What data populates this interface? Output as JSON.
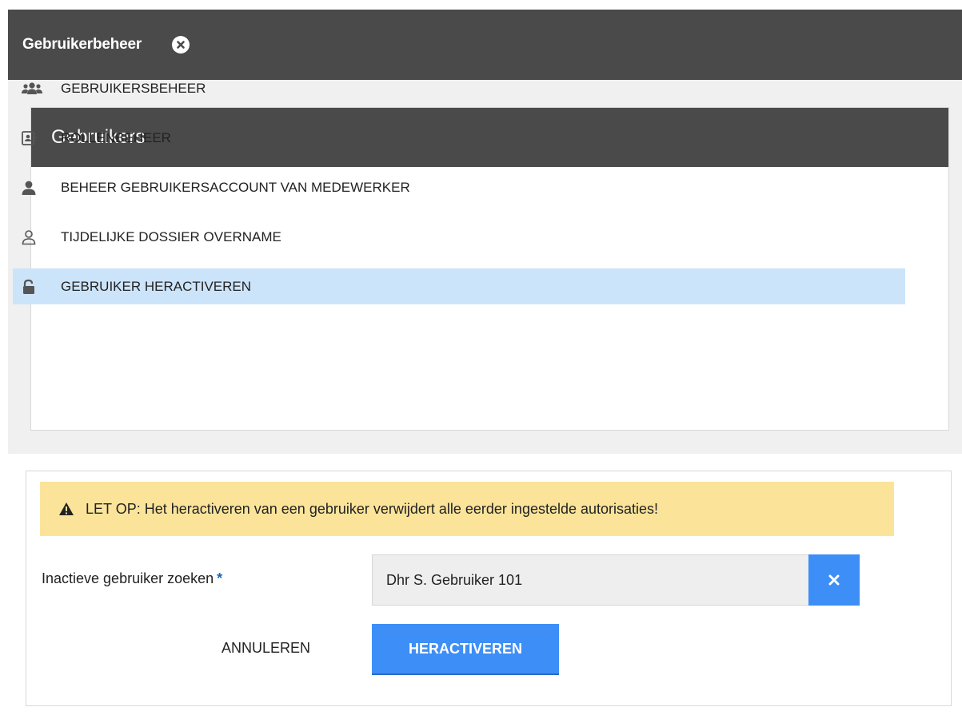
{
  "topbar": {
    "title": "Gebruikerbeheer",
    "close_icon": "close-circle-icon"
  },
  "menu": {
    "header": "Gebruikers",
    "items": [
      {
        "label": "GEBRUIKERSBEHEER",
        "icon": "users-group-icon"
      },
      {
        "label": "ROLLENBEHEER",
        "icon": "contact-card-icon"
      },
      {
        "label": "BEHEER GEBRUIKERSACCOUNT VAN MEDEWERKER",
        "icon": "user-icon"
      },
      {
        "label": "TIJDELIJKE DOSSIER OVERNAME",
        "icon": "user-outline-icon"
      },
      {
        "label": "GEBRUIKER HERACTIVEREN",
        "icon": "unlock-icon",
        "active": true
      }
    ]
  },
  "form": {
    "warning": "LET OP: Het heractiveren van een gebruiker verwijdert alle eerder ingestelde autorisaties!",
    "field_label": "Inactieve gebruiker zoeken",
    "required_marker": "*",
    "search_value": "Dhr S. Gebruiker 101",
    "cancel_label": "ANNULEREN",
    "submit_label": "HERACTIVEREN"
  },
  "colors": {
    "header_bg": "#4a4a4a",
    "accent": "#3d8ef6",
    "active_item": "#cce4fa",
    "warning_bg": "#fbe49a"
  }
}
